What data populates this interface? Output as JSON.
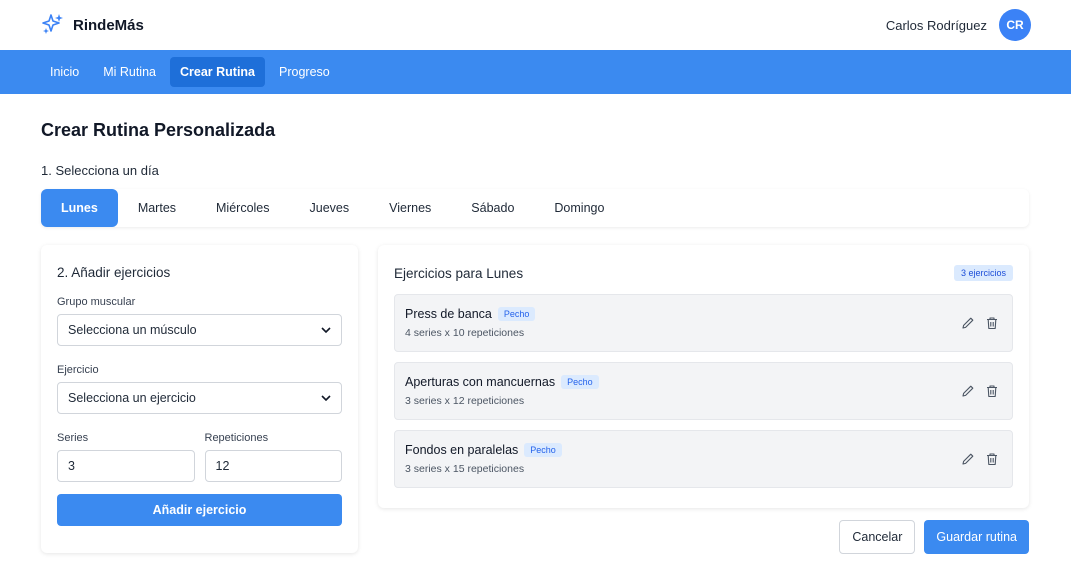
{
  "app": {
    "brand": "RindeMás",
    "logo_icon": "sparkles-icon",
    "accent": "#3b8af0"
  },
  "user": {
    "name": "Carlos Rodríguez",
    "initials": "CR"
  },
  "nav": {
    "items": [
      {
        "label": "Inicio",
        "active": false
      },
      {
        "label": "Mi Rutina",
        "active": false
      },
      {
        "label": "Crear Rutina",
        "active": true
      },
      {
        "label": "Progreso",
        "active": false
      }
    ]
  },
  "page": {
    "title": "Crear Rutina Personalizada",
    "step1_label": "1. Selecciona un día",
    "days": [
      {
        "label": "Lunes",
        "active": true
      },
      {
        "label": "Martes",
        "active": false
      },
      {
        "label": "Miércoles",
        "active": false
      },
      {
        "label": "Jueves",
        "active": false
      },
      {
        "label": "Viernes",
        "active": false
      },
      {
        "label": "Sábado",
        "active": false
      },
      {
        "label": "Domingo",
        "active": false
      }
    ]
  },
  "add_form": {
    "title": "2. Añadir ejercicios",
    "muscle_label": "Grupo muscular",
    "muscle_value": "Selecciona un músculo",
    "exercise_label": "Ejercicio",
    "exercise_value": "Selecciona un ejercicio",
    "series_label": "Series",
    "series_value": "3",
    "reps_label": "Repeticiones",
    "reps_value": "12",
    "add_button": "Añadir ejercicio"
  },
  "exercise_panel": {
    "title": "Ejercicios para Lunes",
    "count_badge": "3 ejercicios",
    "items": [
      {
        "name": "Press de banca",
        "tag": "Pecho",
        "detail": "4 series x 10 repeticiones"
      },
      {
        "name": "Aperturas con mancuernas",
        "tag": "Pecho",
        "detail": "3 series x 12 repeticiones"
      },
      {
        "name": "Fondos en paralelas",
        "tag": "Pecho",
        "detail": "3 series x 15 repeticiones"
      }
    ]
  },
  "actions": {
    "cancel": "Cancelar",
    "save": "Guardar rutina"
  }
}
